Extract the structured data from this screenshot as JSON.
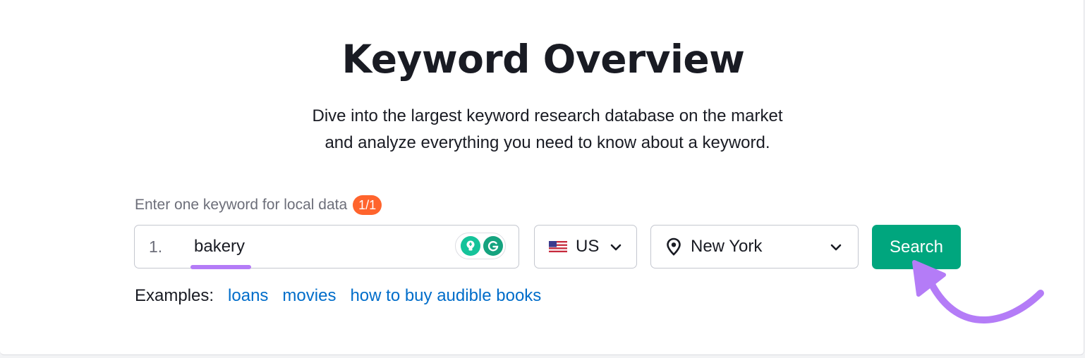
{
  "header": {
    "title": "Keyword Overview",
    "subtitle_line1": "Dive into the largest keyword research database on the market",
    "subtitle_line2": "and analyze everything you need to know about a keyword."
  },
  "form": {
    "label": "Enter one keyword for local data",
    "counter": "1/1",
    "keyword_index": "1.",
    "keyword_value": "bakery",
    "database": {
      "selected": "US",
      "flag_icon": "us-flag-icon",
      "chevron_icon": "chevron-down-icon"
    },
    "location": {
      "selected": "New York",
      "pin_icon": "location-pin-icon",
      "chevron_icon": "chevron-down-icon"
    },
    "search_label": "Search"
  },
  "examples": {
    "label": "Examples:",
    "items": [
      "loans",
      "movies",
      "how to buy audible books"
    ]
  },
  "colors": {
    "accent_green": "#00a67e",
    "badge_orange": "#ff642d",
    "link_blue": "#006dca",
    "highlight_purple": "#b47cf7"
  }
}
